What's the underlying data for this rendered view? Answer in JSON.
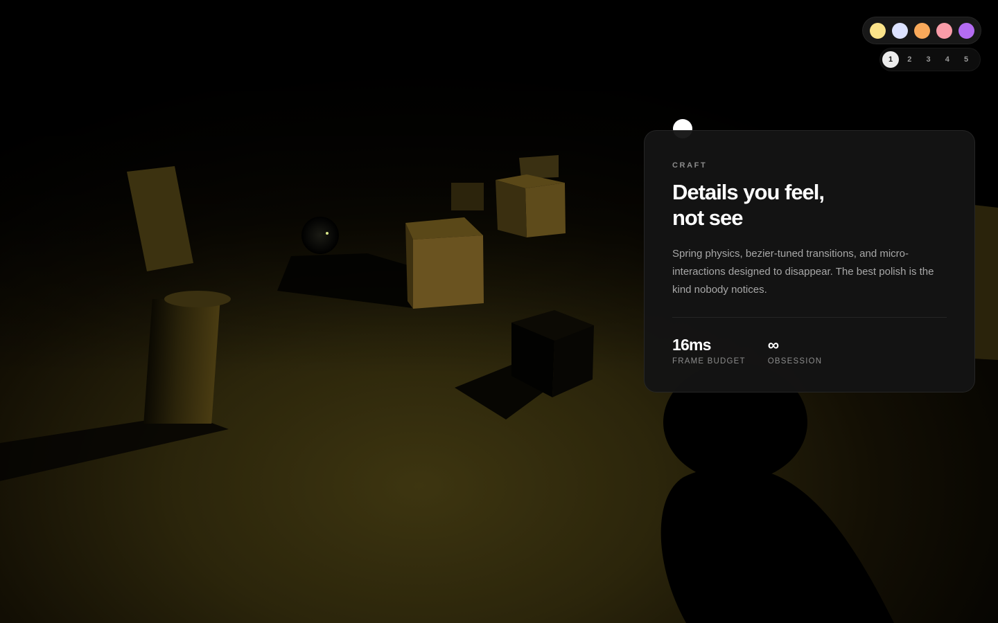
{
  "theme": {
    "swatches": [
      {
        "name": "yellow",
        "color": "#FBE38A"
      },
      {
        "name": "lavender",
        "color": "#DCE2FF"
      },
      {
        "name": "orange",
        "color": "#F9A95A"
      },
      {
        "name": "pink",
        "color": "#F99CA8"
      },
      {
        "name": "purple",
        "color": "#B46CF2"
      }
    ]
  },
  "pager": {
    "pages": [
      "1",
      "2",
      "3",
      "4",
      "5"
    ],
    "active": "1"
  },
  "card": {
    "eyebrow": "CRAFT",
    "title_line1": "Details you feel,",
    "title_line2": "not see",
    "description": "Spring physics, bezier-tuned transitions, and micro-interactions designed to disappear. The best polish is the kind nobody notices.",
    "stats": [
      {
        "value": "16ms",
        "label": "FRAME BUDGET"
      },
      {
        "value": "∞",
        "label": "OBSESSION"
      }
    ]
  }
}
